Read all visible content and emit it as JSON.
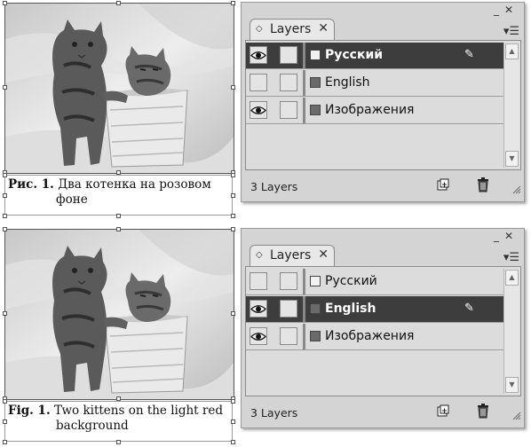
{
  "scenes": [
    {
      "caption": {
        "label": "Рис. 1.",
        "text_line1": "Два котенка на розовом",
        "text_line2": "фоне"
      },
      "layers_panel": {
        "tab_title": "Layers",
        "status": "3 Layers",
        "layers": [
          {
            "name": "Русский",
            "visible": true,
            "selected": true,
            "swatch_color": "#f2f2f2"
          },
          {
            "name": "English",
            "visible": false,
            "selected": false,
            "swatch_color": "#6a6a6a"
          },
          {
            "name": "Изображения",
            "visible": true,
            "selected": false,
            "swatch_color": "#6a6a6a"
          }
        ]
      }
    },
    {
      "caption": {
        "label": "Fig. 1.",
        "text_line1": "Two kittens on the light red",
        "text_line2": "background"
      },
      "layers_panel": {
        "tab_title": "Layers",
        "status": "3 Layers",
        "layers": [
          {
            "name": "Русский",
            "visible": false,
            "selected": false,
            "swatch_color": "#f2f2f2"
          },
          {
            "name": "English",
            "visible": true,
            "selected": true,
            "swatch_color": "#6a6a6a"
          },
          {
            "name": "Изображения",
            "visible": true,
            "selected": false,
            "swatch_color": "#6a6a6a"
          }
        ]
      }
    }
  ],
  "icons": {
    "tab_diamond": "diamond-icon",
    "tab_close": "close-icon",
    "minimize": "minimize-icon",
    "panel_close": "close-icon",
    "panel_menu": "panel-menu-icon",
    "visibility": "eye-icon",
    "pen": "pen-icon",
    "new_layer": "new-layer-icon",
    "delete": "trash-icon",
    "resize": "resize-grip-icon"
  },
  "colors": {
    "selected_row": "#3d3d3d",
    "panel_bg": "#d4d4d4"
  }
}
